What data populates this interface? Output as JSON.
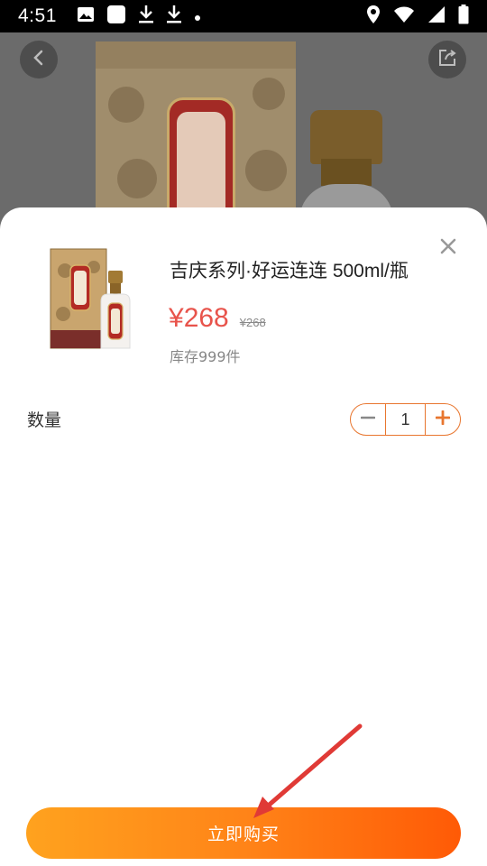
{
  "status_bar": {
    "time": "4:51",
    "left_icons": [
      "image-icon",
      "app-square-icon",
      "download-icon",
      "download-icon",
      "dot-icon"
    ],
    "right_icons": [
      "location-icon",
      "wifi-icon",
      "signal-icon",
      "battery-icon"
    ]
  },
  "background": {
    "back_icon": "chevron-left-icon",
    "share_icon": "share-icon"
  },
  "sheet": {
    "product_title": "吉庆系列·好运连连 500ml/瓶",
    "price_symbol": "¥",
    "price_value": "268",
    "original_price": "¥268",
    "stock": "库存999件",
    "quantity_label": "数量",
    "quantity_value": "1",
    "buy_label": "立即购买",
    "close_icon": "close-icon",
    "accent_color": "#e8534b",
    "stepper_color": "#e8762f",
    "button_gradient": [
      "#ffa21e",
      "#ff5a06"
    ]
  }
}
